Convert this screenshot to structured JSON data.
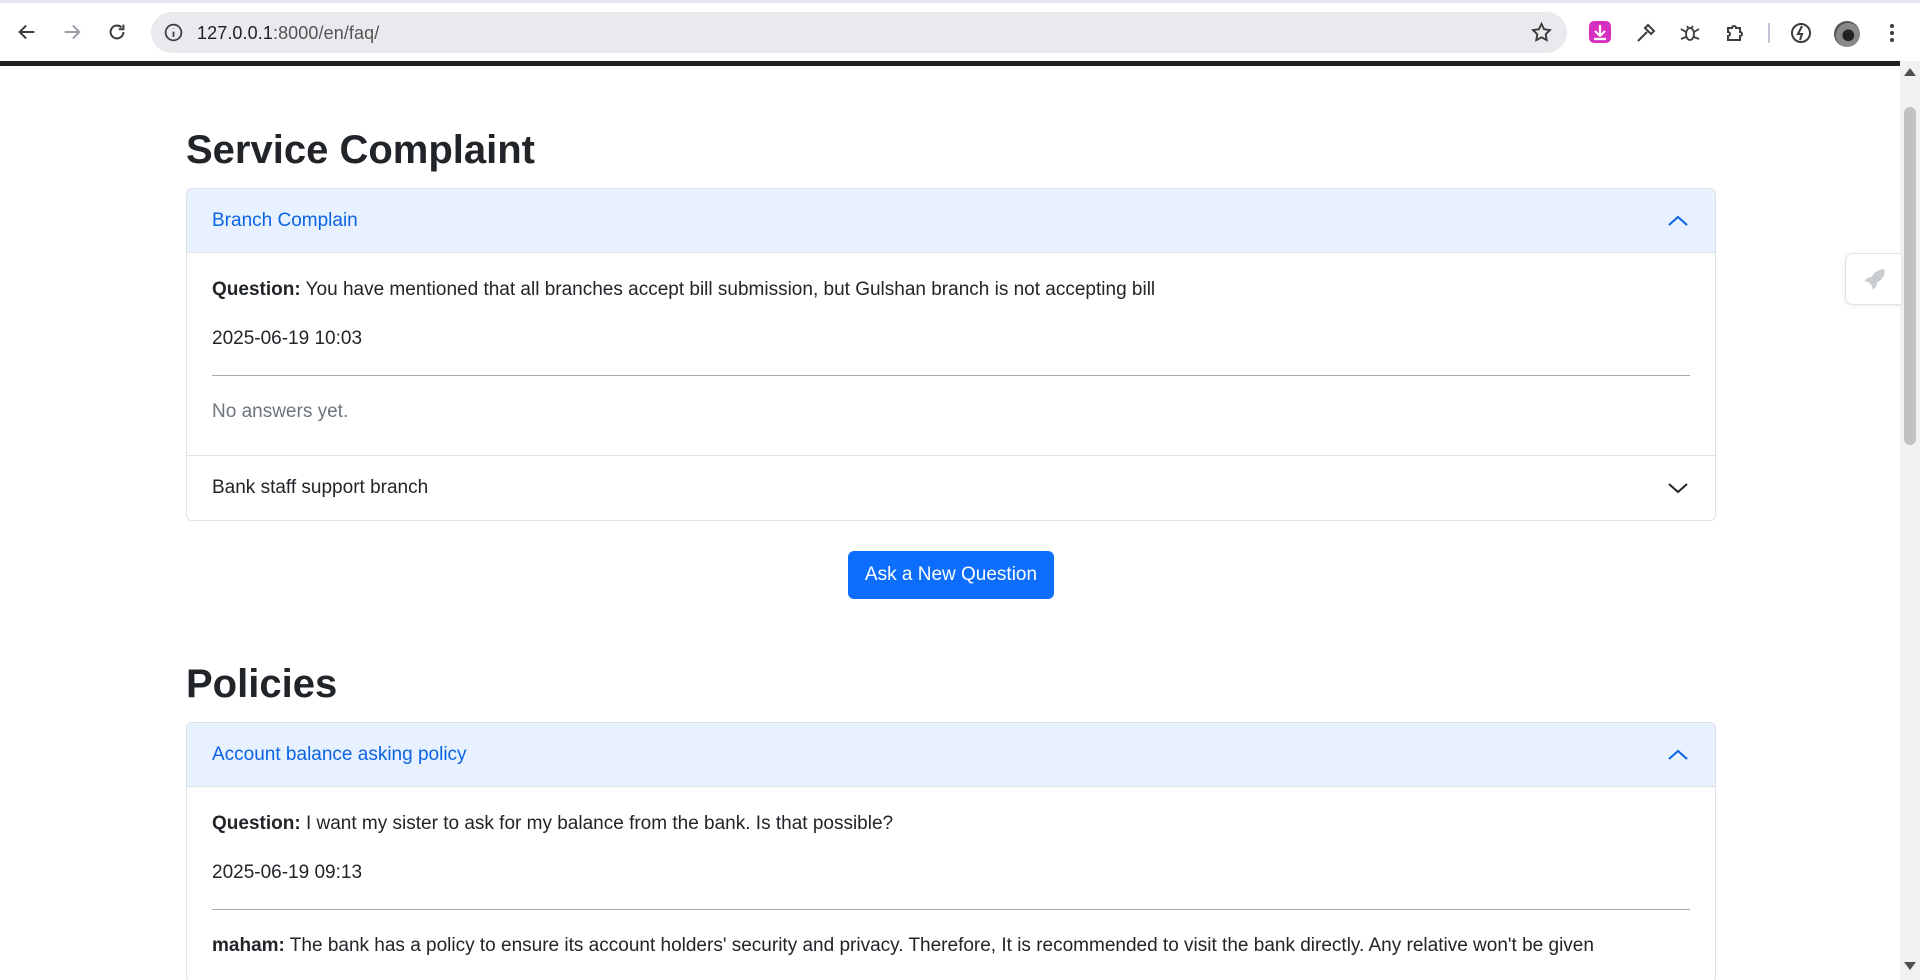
{
  "browser": {
    "url_host": "127.0.0.1",
    "url_path": ":8000/en/faq/"
  },
  "colors": {
    "accent": "#0d6efd",
    "header_open_bg": "#e7f1ff",
    "header_open_text": "#0c63e4"
  },
  "sections": [
    {
      "title": "Service Complaint",
      "items": [
        {
          "label": "Branch Complain",
          "expanded": true,
          "question_label": "Question:",
          "question": "You have mentioned that all branches accept bill submission, but Gulshan branch is not accepting bill",
          "timestamp": "2025-06-19 10:03",
          "answer_placeholder": "No answers yet."
        },
        {
          "label": "Bank staff support branch",
          "expanded": false
        }
      ],
      "ask_button": "Ask a New Question"
    },
    {
      "title": "Policies",
      "items": [
        {
          "label": "Account balance asking policy",
          "expanded": true,
          "question_label": "Question:",
          "question": "I want my sister to ask for my balance from the bank. Is that possible?",
          "timestamp": "2025-06-19 09:13",
          "answer_author": "maham:",
          "answer": "The bank has a policy to ensure its account holders' security and privacy. Therefore, It is recommended to visit the bank directly. Any relative won't be given"
        }
      ]
    }
  ],
  "icons": {
    "back": "arrow-left-icon",
    "forward": "arrow-right-icon",
    "reload": "reload-icon",
    "site_info": "info-icon",
    "bookmark": "star-icon",
    "menu": "kebab-menu-icon"
  }
}
